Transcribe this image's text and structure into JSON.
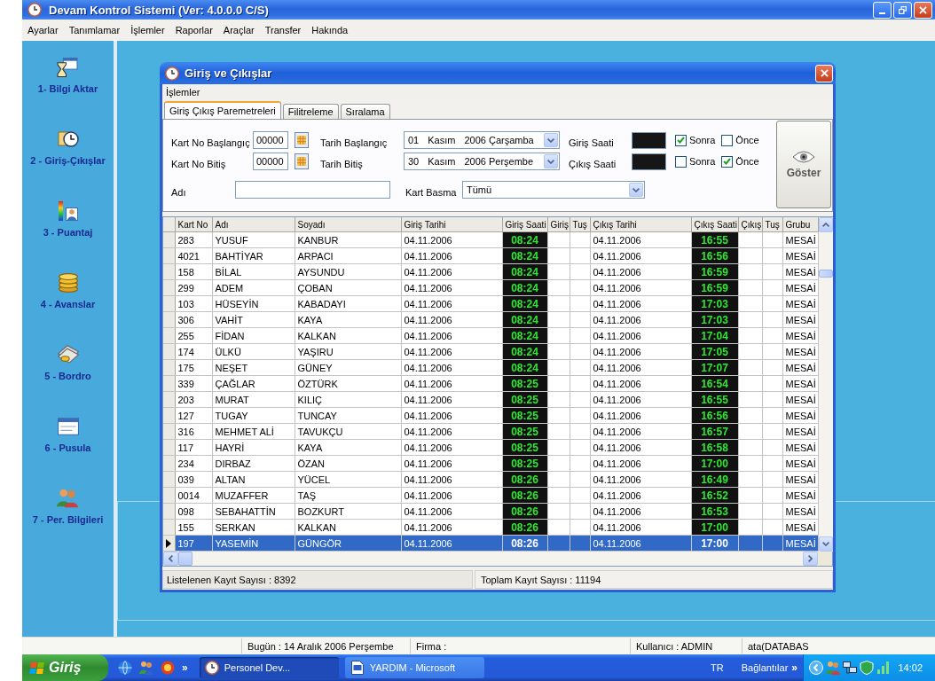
{
  "window": {
    "title": "Devam Kontrol Sistemi (Ver: 4.0.0.0 C/S)"
  },
  "menu": [
    "Ayarlar",
    "Tanımlamar",
    "İşlemler",
    "Raporlar",
    "Araçlar",
    "Transfer",
    "Hakında"
  ],
  "sidebar": {
    "items": [
      "1- Bilgi Aktar",
      "2 - Giriş-Çıkışlar",
      "3 - Puantaj",
      "4 - Avanslar",
      "5 - Bordro",
      "6 - Pusula",
      "7 - Per. Bilgileri"
    ]
  },
  "dialog": {
    "title": "Giriş ve Çıkışlar",
    "menu": [
      "İşlemler"
    ],
    "tabs": [
      {
        "label": "Giriş Çıkış Paremetreleri",
        "selected": true
      },
      {
        "label": "Filitreleme",
        "selected": false
      },
      {
        "label": "Sıralama",
        "selected": false
      }
    ],
    "filters": {
      "card_start": {
        "label": "Kart No Başlangıç",
        "value": "00000"
      },
      "card_end": {
        "label": "Kart No Bitiş",
        "value": "00000"
      },
      "date_start": {
        "label": "Tarih Başlangıç",
        "day": "01",
        "month": "Kasım",
        "year_weekday": "2006 Çarşamba"
      },
      "date_end": {
        "label": "Tarih Bitiş",
        "day": "30",
        "month": "Kasım",
        "year_weekday": "2006 Perşembe"
      },
      "time_in": {
        "label": "Giriş Saati",
        "options": [
          {
            "label": "Sonra",
            "checked": true
          },
          {
            "label": "Önce",
            "checked": false
          }
        ]
      },
      "time_out": {
        "label": "Çıkış Saati",
        "options": [
          {
            "label": "Sonra",
            "checked": false
          },
          {
            "label": "Önce",
            "checked": true
          }
        ]
      },
      "name": {
        "label": "Adı"
      },
      "card_swipe": {
        "label": "Kart Basma",
        "value": "Tümü"
      }
    },
    "show_button": "Göster",
    "grid": {
      "columns": [
        "Kart No",
        "Adı",
        "Soyadı",
        "Giriş Tarihi",
        "Giriş Saati",
        "Giriş",
        "Tuş",
        "Çıkış Tarihi",
        "Çıkış Saati",
        "Çıkış",
        "Tuş",
        "Grubu"
      ],
      "rows": [
        {
          "card_no": "283",
          "name": "YUSUF",
          "surname": "KANBUR",
          "in_date": "04.11.2006",
          "in_time": "08:24",
          "out_date": "04.11.2006",
          "out_time": "16:55",
          "group": "MESAİ",
          "selected": false
        },
        {
          "card_no": "4021",
          "name": "BAHTİYAR",
          "surname": "ARPACI",
          "in_date": "04.11.2006",
          "in_time": "08:24",
          "out_date": "04.11.2006",
          "out_time": "16:56",
          "group": "MESAİ",
          "selected": false
        },
        {
          "card_no": "158",
          "name": "BİLAL",
          "surname": "AYSUNDU",
          "in_date": "04.11.2006",
          "in_time": "08:24",
          "out_date": "04.11.2006",
          "out_time": "16:59",
          "group": "MESAİ",
          "selected": false
        },
        {
          "card_no": "299",
          "name": "ADEM",
          "surname": "ÇOBAN",
          "in_date": "04.11.2006",
          "in_time": "08:24",
          "out_date": "04.11.2006",
          "out_time": "16:59",
          "group": "MESAİ",
          "selected": false
        },
        {
          "card_no": "103",
          "name": "HÜSEYİN",
          "surname": "KABADAYI",
          "in_date": "04.11.2006",
          "in_time": "08:24",
          "out_date": "04.11.2006",
          "out_time": "17:03",
          "group": "MESAİ",
          "selected": false
        },
        {
          "card_no": "306",
          "name": "VAHİT",
          "surname": "KAYA",
          "in_date": "04.11.2006",
          "in_time": "08:24",
          "out_date": "04.11.2006",
          "out_time": "17:03",
          "group": "MESAİ",
          "selected": false
        },
        {
          "card_no": "255",
          "name": "FİDAN",
          "surname": "KALKAN",
          "in_date": "04.11.2006",
          "in_time": "08:24",
          "out_date": "04.11.2006",
          "out_time": "17:04",
          "group": "MESAİ",
          "selected": false
        },
        {
          "card_no": "174",
          "name": "ÜLKÜ",
          "surname": "YAŞIRU",
          "in_date": "04.11.2006",
          "in_time": "08:24",
          "out_date": "04.11.2006",
          "out_time": "17:05",
          "group": "MESAİ",
          "selected": false
        },
        {
          "card_no": "175",
          "name": "NEŞET",
          "surname": "GÜNEY",
          "in_date": "04.11.2006",
          "in_time": "08:24",
          "out_date": "04.11.2006",
          "out_time": "17:07",
          "group": "MESAİ",
          "selected": false
        },
        {
          "card_no": "339",
          "name": "ÇAĞLAR",
          "surname": "ÖZTÜRK",
          "in_date": "04.11.2006",
          "in_time": "08:25",
          "out_date": "04.11.2006",
          "out_time": "16:54",
          "group": "MESAİ",
          "selected": false
        },
        {
          "card_no": "203",
          "name": "MURAT",
          "surname": "KILIÇ",
          "in_date": "04.11.2006",
          "in_time": "08:25",
          "out_date": "04.11.2006",
          "out_time": "16:55",
          "group": "MESAİ",
          "selected": false
        },
        {
          "card_no": "127",
          "name": "TUGAY",
          "surname": "TUNCAY",
          "in_date": "04.11.2006",
          "in_time": "08:25",
          "out_date": "04.11.2006",
          "out_time": "16:56",
          "group": "MESAİ",
          "selected": false
        },
        {
          "card_no": "316",
          "name": "MEHMET ALİ",
          "surname": "TAVUKÇU",
          "in_date": "04.11.2006",
          "in_time": "08:25",
          "out_date": "04.11.2006",
          "out_time": "16:57",
          "group": "MESAİ",
          "selected": false
        },
        {
          "card_no": "117",
          "name": "HAYRİ",
          "surname": "KAYA",
          "in_date": "04.11.2006",
          "in_time": "08:25",
          "out_date": "04.11.2006",
          "out_time": "16:58",
          "group": "MESAİ",
          "selected": false
        },
        {
          "card_no": "234",
          "name": "DIRBAZ",
          "surname": "ÖZAN",
          "in_date": "04.11.2006",
          "in_time": "08:25",
          "out_date": "04.11.2006",
          "out_time": "17:00",
          "group": "MESAİ",
          "selected": false
        },
        {
          "card_no": "039",
          "name": "ALTAN",
          "surname": "YÜCEL",
          "in_date": "04.11.2006",
          "in_time": "08:26",
          "out_date": "04.11.2006",
          "out_time": "16:49",
          "group": "MESAİ",
          "selected": false
        },
        {
          "card_no": "0014",
          "name": "MUZAFFER",
          "surname": "TAŞ",
          "in_date": "04.11.2006",
          "in_time": "08:26",
          "out_date": "04.11.2006",
          "out_time": "16:52",
          "group": "MESAİ",
          "selected": false
        },
        {
          "card_no": "098",
          "name": "SEBAHATTİN",
          "surname": "BOZKURT",
          "in_date": "04.11.2006",
          "in_time": "08:26",
          "out_date": "04.11.2006",
          "out_time": "16:53",
          "group": "MESAİ",
          "selected": false
        },
        {
          "card_no": "155",
          "name": "SERKAN",
          "surname": "KALKAN",
          "in_date": "04.11.2006",
          "in_time": "08:26",
          "out_date": "04.11.2006",
          "out_time": "17:00",
          "group": "MESAİ",
          "selected": false
        },
        {
          "card_no": "197",
          "name": "YASEMİN",
          "surname": "GÜNGÖR",
          "in_date": "04.11.2006",
          "in_time": "08:26",
          "out_date": "04.11.2006",
          "out_time": "17:00",
          "group": "MESAİ",
          "selected": true
        }
      ]
    },
    "footer": {
      "listed": "Listelenen Kayıt Sayısı : 8392",
      "total": "Toplam Kayıt Sayısı : 11194"
    }
  },
  "status_bar": [
    "Bugün : 14 Aralık 2006 Perşembe",
    "Firma :",
    "Kullanıcı : ADMIN",
    "ata(DATABAS"
  ],
  "taskbar": {
    "start": "Giriş",
    "quick_launch_more": "»",
    "tasks": [
      {
        "label": "Personel Dev...",
        "selected": true
      },
      {
        "label": "YARDIM - Microsoft",
        "selected": false
      }
    ],
    "language": "TR",
    "links": "Bağlantılar",
    "links_more": "»",
    "clock": "14:02"
  }
}
